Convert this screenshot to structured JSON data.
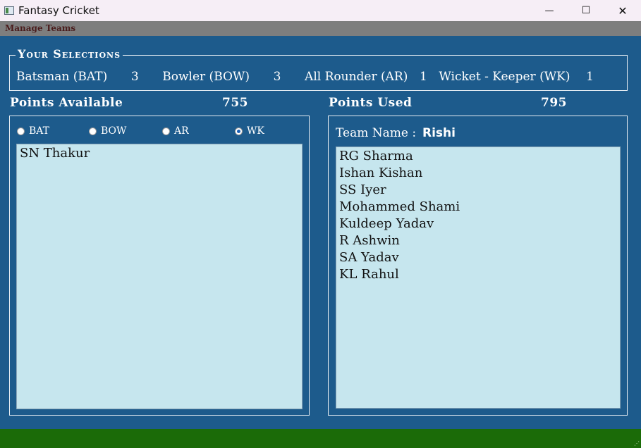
{
  "window": {
    "title": "Fantasy Cricket",
    "minimize_glyph": "—",
    "maximize_glyph": "☐",
    "close_glyph": "✕"
  },
  "menu": {
    "items": [
      "Manage Teams"
    ]
  },
  "selections": {
    "legend": "Your Selections",
    "batsman_label": "Batsman (BAT)",
    "batsman_count": "3",
    "bowler_label": "Bowler (BOW)",
    "bowler_count": "3",
    "allrounder_label": "All Rounder (AR)",
    "allrounder_count": "1",
    "wicketkeeper_label": "Wicket - Keeper (WK)",
    "wicketkeeper_count": "1"
  },
  "points": {
    "available_label": "Points Available",
    "available_value": "755",
    "used_label": "Points Used",
    "used_value": "795"
  },
  "filters": {
    "options": [
      "BAT",
      "BOW",
      "AR",
      "WK"
    ],
    "selected": "WK"
  },
  "available_players": [
    "SN Thakur"
  ],
  "team": {
    "name_label": "Team Name :",
    "name": "Rishi",
    "players": [
      "RG Sharma",
      "Ishan Kishan",
      "SS Iyer",
      "Mohammed Shami",
      "Kuldeep Yadav",
      "R Ashwin",
      "SA Yadav",
      "KL Rahul"
    ]
  },
  "colors": {
    "window_bg": "#1d5b8c",
    "list_bg": "#c6e6ee",
    "menubar_bg": "#7e7e7e",
    "statusbar_bg": "#1b6b08",
    "menu_text": "#4a1c1c"
  }
}
